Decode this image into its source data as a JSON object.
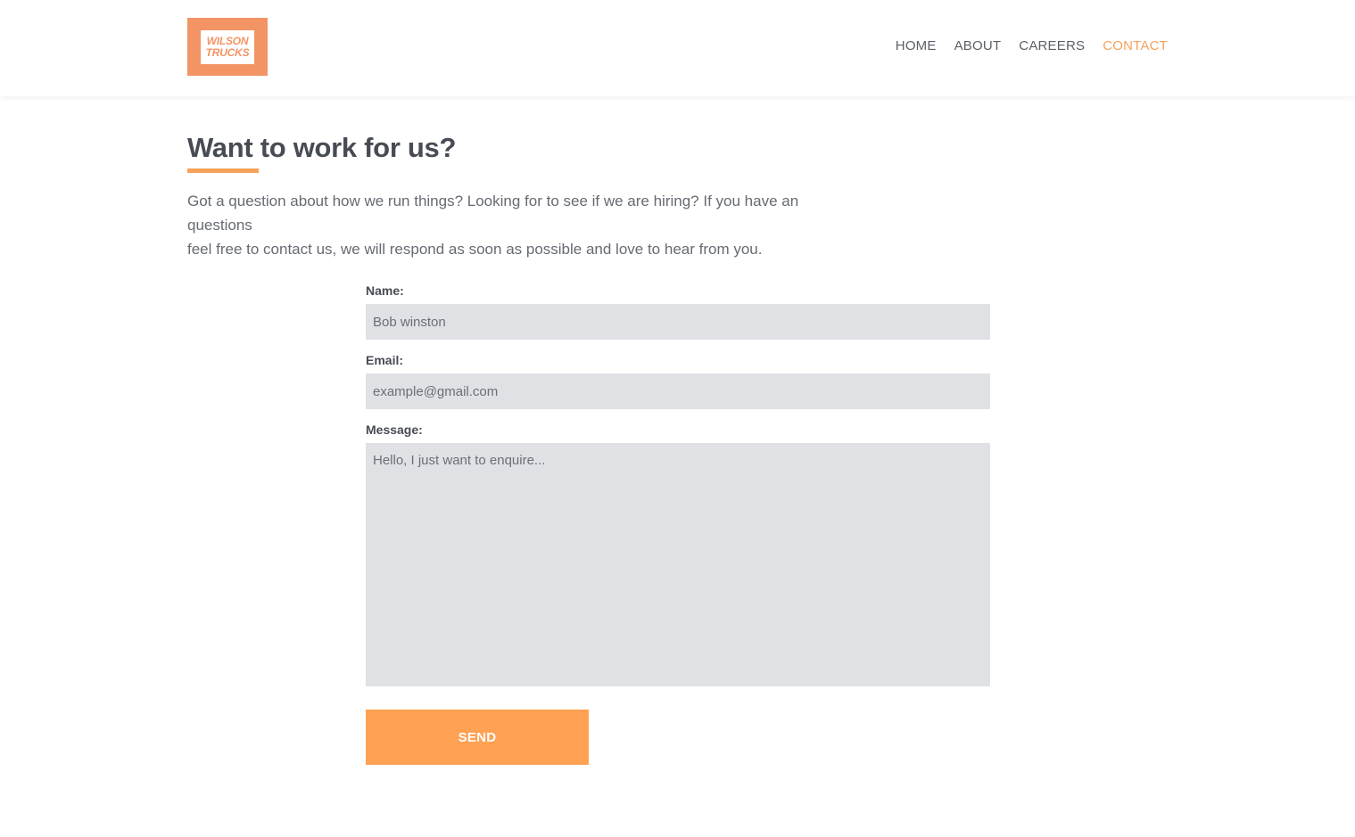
{
  "brand": {
    "logo_line1": "WILSON",
    "logo_line2": "TRUCKS",
    "accent_color": "#f7a15a",
    "logo_color": "#f39465"
  },
  "nav": {
    "items": [
      {
        "label": "HOME",
        "active": false
      },
      {
        "label": "ABOUT",
        "active": false
      },
      {
        "label": "CAREERS",
        "active": false
      },
      {
        "label": "CONTACT",
        "active": true
      }
    ]
  },
  "main": {
    "title": "Want to work for us?",
    "intro_line1": "Got a question about how we run things? Looking for to see if we are hiring? If you have an questions",
    "intro_line2": "feel free to contact us, we will respond as soon as possible and love to hear from you."
  },
  "form": {
    "name_label": "Name:",
    "name_placeholder": "Bob winston",
    "email_label": "Email:",
    "email_placeholder": "example@gmail.com",
    "message_label": "Message:",
    "message_placeholder": "Hello, I just want to enquire...",
    "send_label": "SEND"
  }
}
